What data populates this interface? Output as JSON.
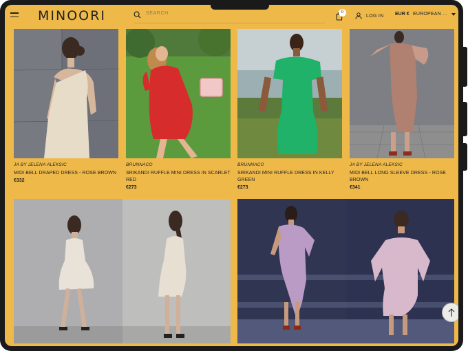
{
  "header": {
    "logo": "MINOORI",
    "search_placeholder": "SEARCH",
    "cart_count": "0",
    "login_label": "LOG IN",
    "currency": "EUR €",
    "region": "EUROPEAN ..."
  },
  "products": [
    {
      "brand": "JA BY JELENA ALEKSIC",
      "title": "MIDI BELL DRAPED DRESS - ROSE BROWN",
      "price": "€332"
    },
    {
      "brand": "BRUNNACO",
      "title": "SRIKANDI RUFFLE MINI DRESS IN SCARLET RED",
      "price": "€273"
    },
    {
      "brand": "BRUNNACO",
      "title": "SRIKANDI MINI RUFFLE DRESS IN KELLY GREEN",
      "price": "€273"
    },
    {
      "brand": "JA BY JELENA ALEKSIC",
      "title": "MIDI BELL LONG SLEEVE DRESS - ROSE BROWN",
      "price": "€341"
    }
  ],
  "colors": {
    "background": "#efb94a",
    "frame": "#1a1a1a"
  },
  "icons": {
    "menu": "hamburger-menu-icon",
    "search": "search-icon",
    "cart": "shopping-bag-icon",
    "user": "user-icon",
    "back_to_top": "arrow-up-icon"
  }
}
